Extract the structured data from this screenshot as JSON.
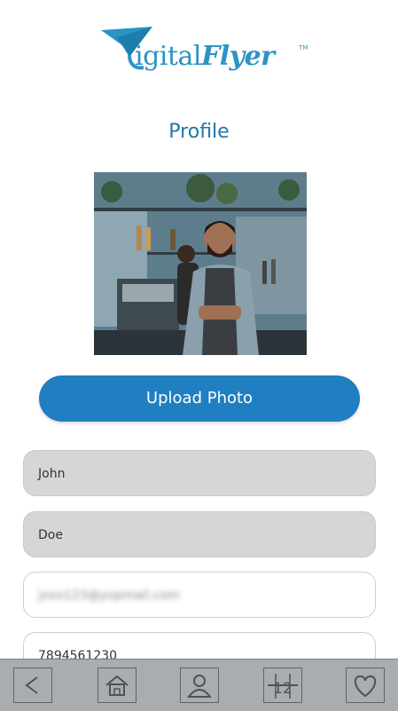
{
  "brand": {
    "name_part1": "igital",
    "name_part2": "Flyer",
    "tm": "TM",
    "color": "#2a94c4"
  },
  "page_title": "Profile",
  "upload_button_label": "Upload Photo",
  "form": {
    "first_name": "John",
    "last_name": "Doe",
    "email": "jxxx123@yopmail.com",
    "phone": "7894561230"
  },
  "navbar": {
    "items": [
      {
        "icon": "back-icon"
      },
      {
        "icon": "home-icon"
      },
      {
        "icon": "profile-icon"
      },
      {
        "icon": "calendar-icon",
        "label": "12"
      },
      {
        "icon": "heart-icon"
      }
    ]
  },
  "colors": {
    "accent": "#1f7fc0",
    "title": "#1f78a8",
    "field_bg": "#d6d6d8",
    "navbar_bg": "#a9adb0"
  }
}
